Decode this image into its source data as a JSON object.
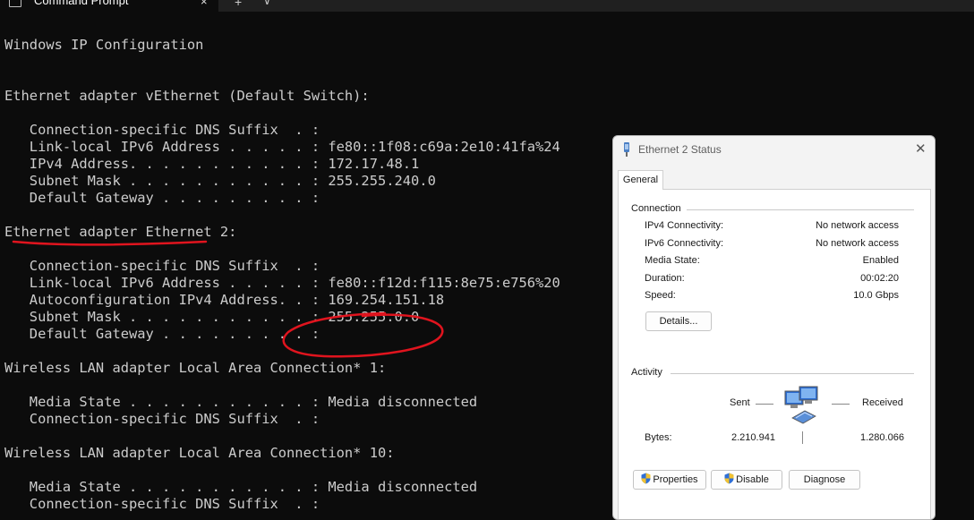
{
  "tab": {
    "title": "Command Prompt",
    "close_glyph": "×",
    "new_tab_glyph": "+",
    "dropdown_glyph": "∨"
  },
  "terminal": {
    "lines": [
      "Windows IP Configuration",
      "",
      "",
      "Ethernet adapter vEthernet (Default Switch):",
      "",
      "   Connection-specific DNS Suffix  . :",
      "   Link-local IPv6 Address . . . . . : fe80::1f08:c69a:2e10:41fa%24",
      "   IPv4 Address. . . . . . . . . . . : 172.17.48.1",
      "   Subnet Mask . . . . . . . . . . . : 255.255.240.0",
      "   Default Gateway . . . . . . . . . :",
      "",
      "Ethernet adapter Ethernet 2:",
      "",
      "   Connection-specific DNS Suffix  . :",
      "   Link-local IPv6 Address . . . . . : fe80::f12d:f115:8e75:e756%20",
      "   Autoconfiguration IPv4 Address. . : 169.254.151.18",
      "   Subnet Mask . . . . . . . . . . . : 255.255.0.0",
      "   Default Gateway . . . . . . . . . :",
      "",
      "Wireless LAN adapter Local Area Connection* 1:",
      "",
      "   Media State . . . . . . . . . . . : Media disconnected",
      "   Connection-specific DNS Suffix  . :",
      "",
      "Wireless LAN adapter Local Area Connection* 10:",
      "",
      "   Media State . . . . . . . . . . . : Media disconnected",
      "   Connection-specific DNS Suffix  . :"
    ]
  },
  "annotation_color": "#e0141e",
  "dialog": {
    "title": "Ethernet 2 Status",
    "close_glyph": "✕",
    "tab_label": "General",
    "connection": {
      "heading": "Connection",
      "rows": [
        {
          "label": "IPv4 Connectivity:",
          "value": "No network access"
        },
        {
          "label": "IPv6 Connectivity:",
          "value": "No network access"
        },
        {
          "label": "Media State:",
          "value": "Enabled"
        },
        {
          "label": "Duration:",
          "value": "00:02:20"
        },
        {
          "label": "Speed:",
          "value": "10.0 Gbps"
        }
      ],
      "details_button": "Details..."
    },
    "activity": {
      "heading": "Activity",
      "sent_label": "Sent",
      "received_label": "Received",
      "bytes_label": "Bytes:",
      "bytes_sent": "2.210.941",
      "bytes_received": "1.280.066"
    },
    "buttons": {
      "properties": "Properties",
      "disable": "Disable",
      "diagnose": "Diagnose"
    }
  }
}
